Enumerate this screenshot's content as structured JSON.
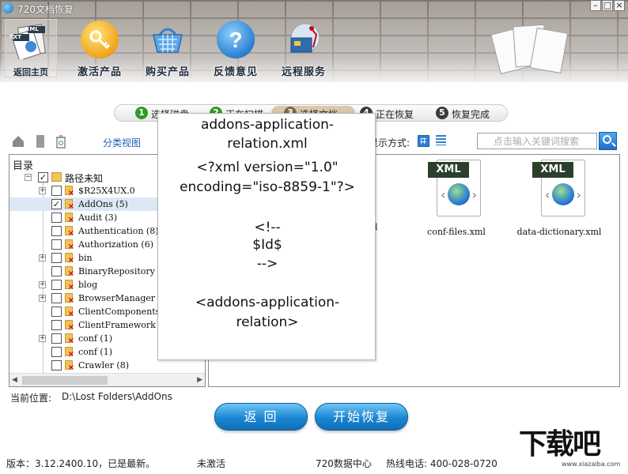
{
  "app": {
    "title": "720文档恢复"
  },
  "window_controls": {
    "minimize": "–",
    "maximize": "□",
    "close": "×"
  },
  "header": {
    "home_label": "返回主页",
    "home_tag_txt": "TXT",
    "home_tag_xml": "XML",
    "toolbar": [
      {
        "name": "activate",
        "label": "激活产品",
        "icon": "key-icon"
      },
      {
        "name": "buy",
        "label": "购买产品",
        "icon": "basket-icon"
      },
      {
        "name": "feedback",
        "label": "反馈意见",
        "icon": "question-icon"
      },
      {
        "name": "remote",
        "label": "远程服务",
        "icon": "toolbox-icon"
      }
    ]
  },
  "steps": [
    {
      "num": "1",
      "label": "选择磁盘",
      "state": "done"
    },
    {
      "num": "2",
      "label": "正在扫描",
      "state": "done"
    },
    {
      "num": "3",
      "label": "选择文档",
      "state": "current"
    },
    {
      "num": "4",
      "label": "正在恢复",
      "state": "todo"
    },
    {
      "num": "5",
      "label": "恢复完成",
      "state": "todo"
    }
  ],
  "toolbar_row": {
    "category_view": "分类视图",
    "display_mode_label": "显示方式:",
    "search_placeholder": "点击输入关键词搜索"
  },
  "tree": {
    "header": "目录",
    "root": {
      "label": "路径未知",
      "checked": true
    },
    "items": [
      {
        "label": "$R25X4UX.0",
        "expandable": true,
        "checked": false
      },
      {
        "label": "AddOns (5)",
        "expandable": false,
        "checked": true,
        "selected": true
      },
      {
        "label": "Audit (3)",
        "expandable": false,
        "checked": false
      },
      {
        "label": "Authentication (8)",
        "expandable": false,
        "checked": false
      },
      {
        "label": "Authorization (6)",
        "expandable": false,
        "checked": false
      },
      {
        "label": "bin",
        "expandable": true,
        "checked": false
      },
      {
        "label": "BinaryRepository",
        "expandable": false,
        "checked": false
      },
      {
        "label": "blog",
        "expandable": true,
        "checked": false
      },
      {
        "label": "BrowserManager (2)",
        "expandable": true,
        "checked": false
      },
      {
        "label": "ClientComponents",
        "expandable": false,
        "checked": false
      },
      {
        "label": "ClientFramework (",
        "expandable": false,
        "checked": false
      },
      {
        "label": "conf (1)",
        "expandable": true,
        "checked": false
      },
      {
        "label": "conf (1)",
        "expandable": false,
        "checked": false
      },
      {
        "label": "Crawler (8)",
        "expandable": false,
        "checked": false
      }
    ]
  },
  "files": [
    {
      "name": "conf-files.xml",
      "tag": "XML"
    },
    {
      "name": "data-dictionary.xml",
      "tag": "XML"
    }
  ],
  "file_partial_names": [
    "l"
  ],
  "preview": {
    "lines": [
      "addons-application-",
      "relation.xml",
      "<?xml version=\"1.0\"",
      "encoding=\"iso-8859-1\"?>",
      "<!--",
      "$Id$",
      "-->",
      "<addons-application-",
      "relation>"
    ]
  },
  "bottom": {
    "path_label": "当前位置:",
    "path_value": "D:\\Lost Folders\\AddOns",
    "back_button": "返 回",
    "start_button": "开始恢复"
  },
  "status_bar": {
    "version": "版本：3.12.2400.10，已是最新。",
    "activation": "未激活",
    "center": "720数据中心",
    "hotline": "热线电话:   400-028-0720"
  },
  "watermark": {
    "glyphs": "下载吧",
    "url": "www.xiazaiba.com"
  },
  "colors": {
    "accent": "#1b86d3",
    "step_done": "#2f9a25",
    "selected_row": "#dde8f5",
    "link": "#1a5fb5"
  }
}
